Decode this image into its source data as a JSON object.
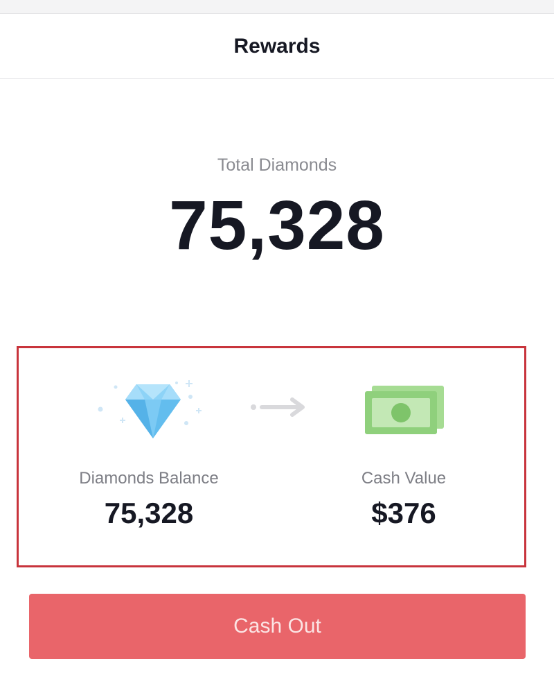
{
  "nav": {
    "title": "Rewards"
  },
  "total": {
    "label": "Total Diamonds",
    "value": "75,328"
  },
  "conversion": {
    "left_icon": "diamond-icon",
    "middle_icon": "arrow-right-icon",
    "right_icon": "cash-icon",
    "diamonds_label": "Diamonds Balance",
    "diamonds_value": "75,328",
    "cash_label": "Cash Value",
    "cash_value": "$376"
  },
  "cashout": {
    "label": "Cash Out"
  },
  "colors": {
    "highlight_border": "#c8343c",
    "cashout_button": "#e9656a",
    "diamond": "#6ec3f0",
    "cash": "#8fd07c",
    "text_primary": "#161823",
    "text_secondary": "#8a8b91"
  }
}
